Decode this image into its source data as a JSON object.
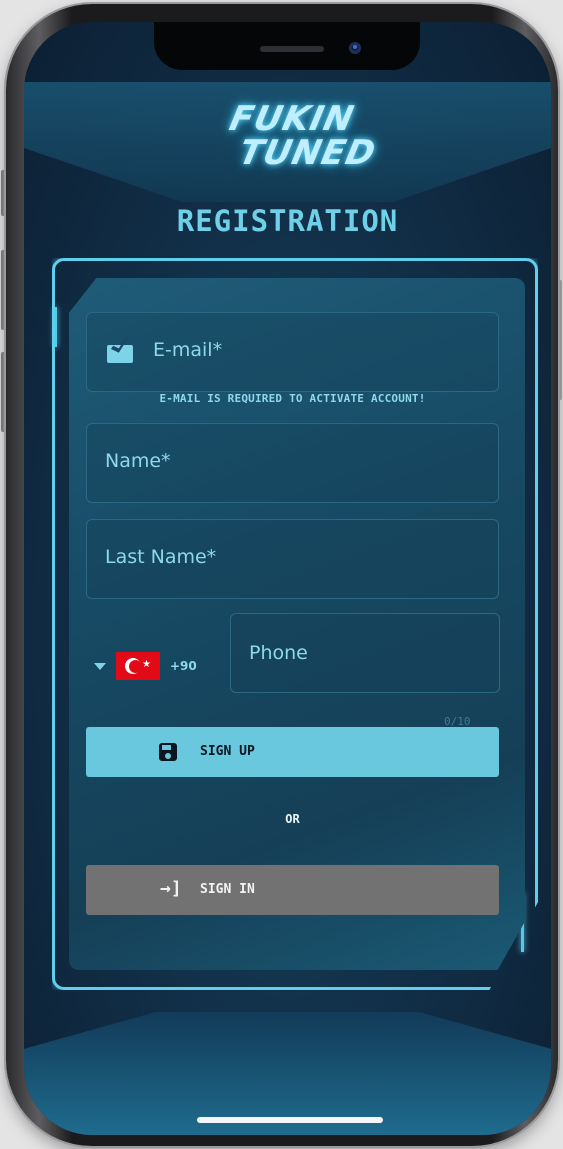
{
  "app": {
    "logo_line1": "FUKIN",
    "logo_line2": "TUNED",
    "title": "REGISTRATION"
  },
  "form": {
    "email_label": "E-mail*",
    "email_hint": "E-MAIL IS REQUIRED TO ACTIVATE ACCOUNT!",
    "name_label": "Name*",
    "last_name_label": "Last Name*",
    "phone_label": "Phone",
    "phone_counter": "0/10",
    "country_code": "+90",
    "country_flag": "turkey-flag-icon"
  },
  "buttons": {
    "sign_up_label": "SIGN UP",
    "separator_label": "OR",
    "sign_in_label": "SIGN IN"
  },
  "colors": {
    "accent": "#6ac8de",
    "frame_neon": "#5fcfee",
    "card_bg": "#174a64",
    "sign_in_bg": "#727272",
    "flag_red": "#e30a17"
  }
}
